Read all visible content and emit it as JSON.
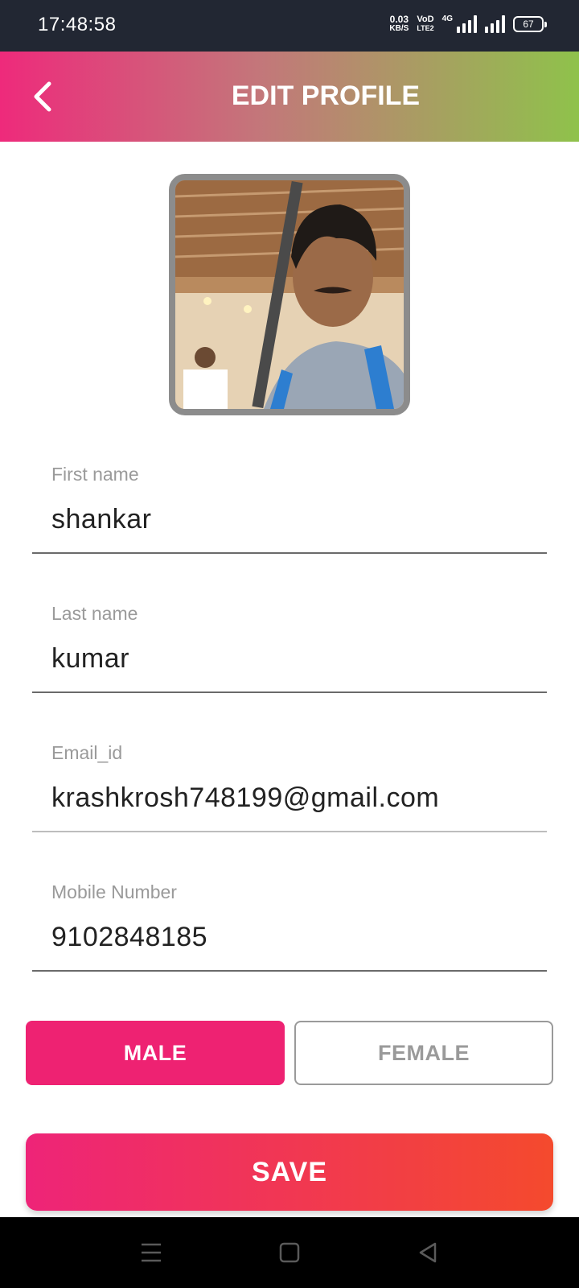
{
  "status_bar": {
    "time": "17:48:58",
    "net_speed_value": "0.03",
    "net_speed_unit": "KB/S",
    "volte_top": "VoD",
    "volte_bottom": "LTE2",
    "network_type": "4G",
    "battery": "67"
  },
  "header": {
    "title": "EDIT PROFILE",
    "back_icon": "chevron-left-icon",
    "gradient_start": "#ee2a7b",
    "gradient_end": "#8fc24b"
  },
  "form": {
    "first_name": {
      "label": "First name",
      "value": "shankar"
    },
    "last_name": {
      "label": "Last name",
      "value": "kumar"
    },
    "email": {
      "label": "Email_id",
      "value": "krashkrosh748199@gmail.com"
    },
    "mobile": {
      "label": "Mobile Number",
      "value": "9102848185"
    }
  },
  "gender": {
    "male_label": "MALE",
    "female_label": "FEMALE",
    "selected": "MALE",
    "selected_color": "#ee2272"
  },
  "actions": {
    "save_label": "SAVE",
    "save_gradient_start": "#ee2478",
    "save_gradient_end": "#f44a2d"
  },
  "nav_bar": {
    "menu_icon": "menu-icon",
    "home_icon": "home-square-icon",
    "back_icon": "back-triangle-icon"
  }
}
